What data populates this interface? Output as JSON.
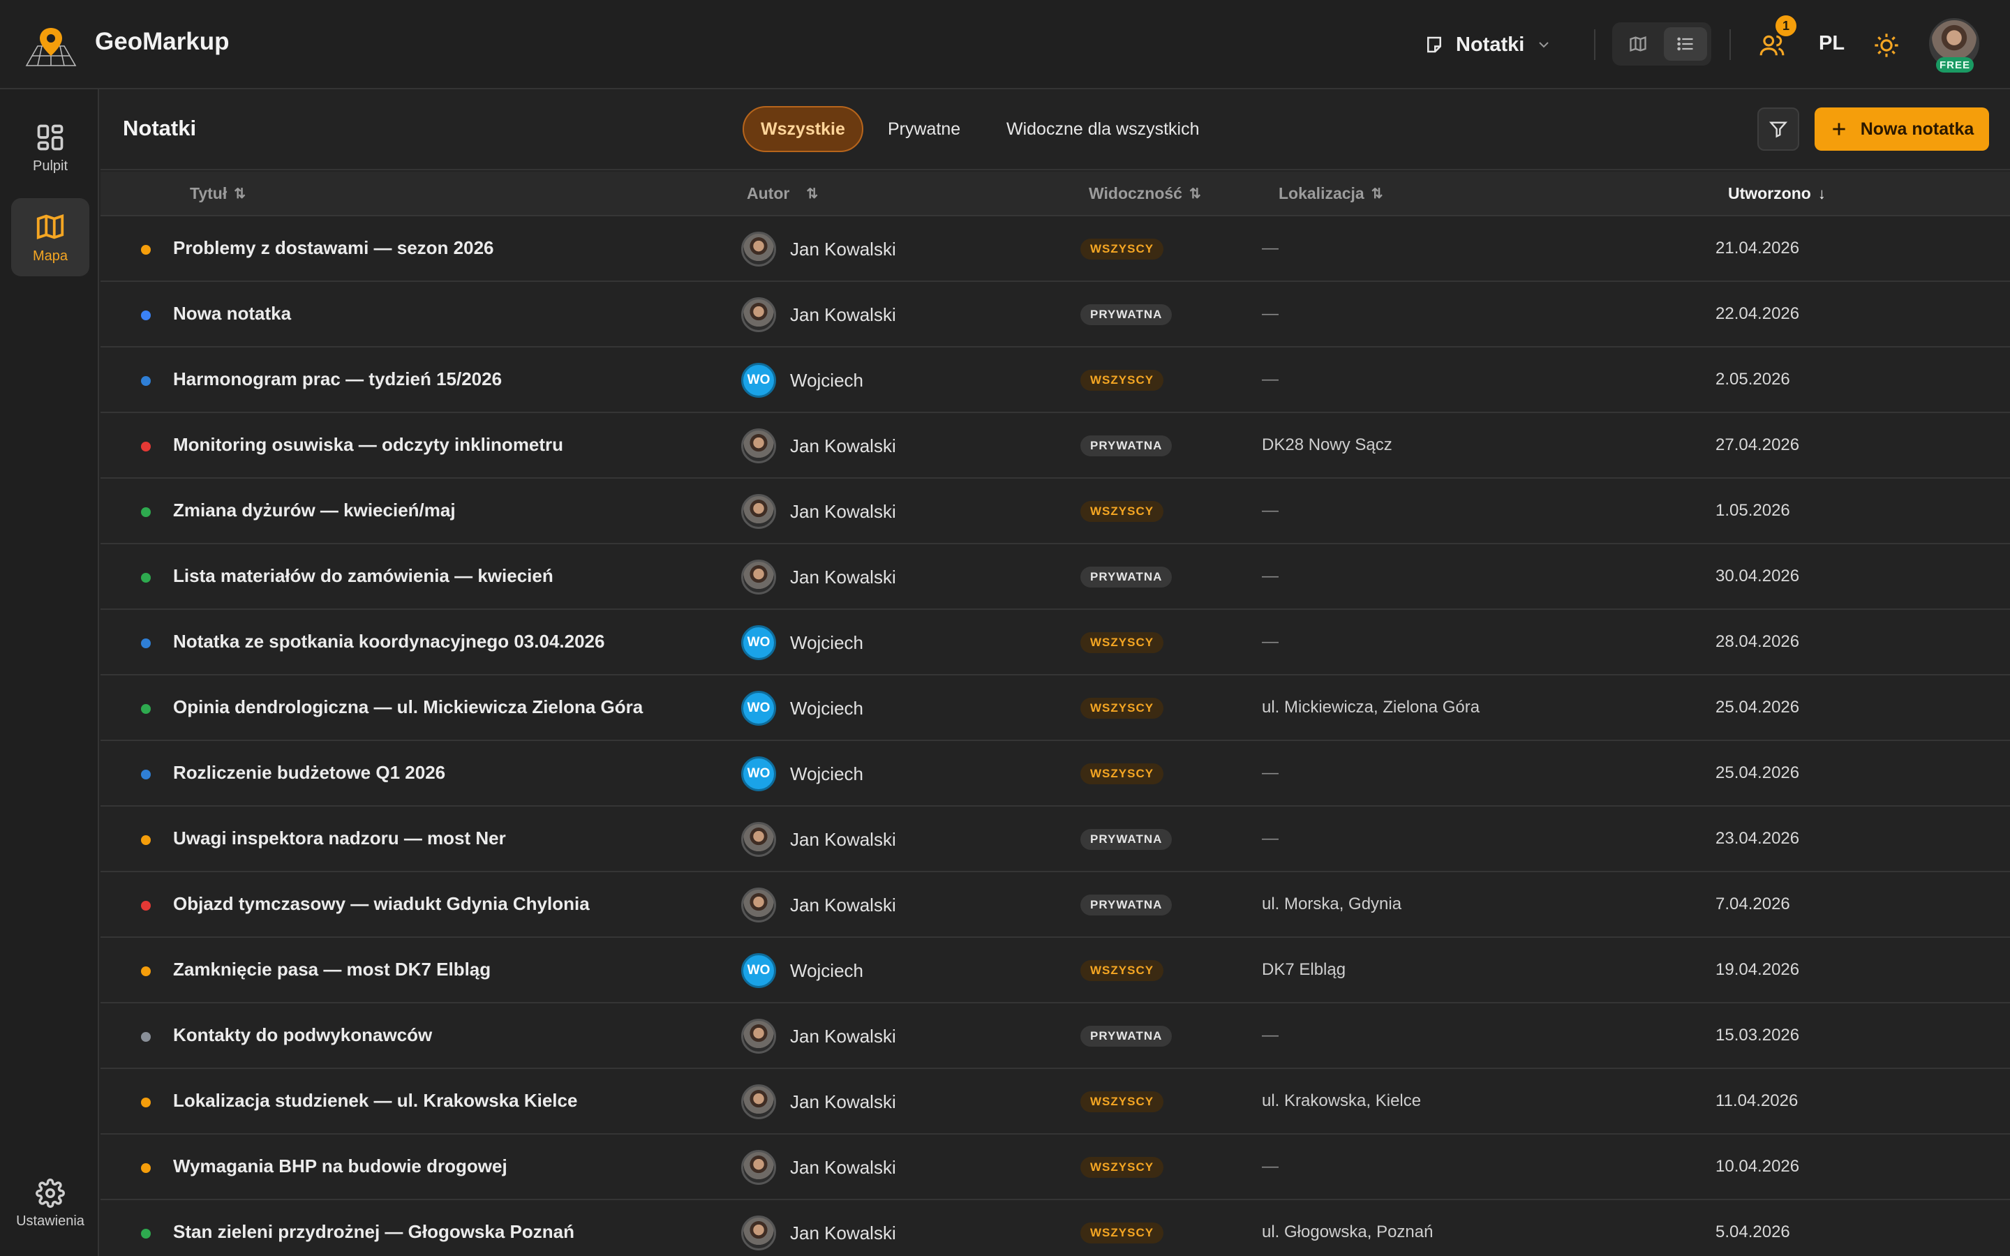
{
  "app": {
    "brand": "GeoMarkup",
    "mode_label": "Notatki",
    "language": "PL",
    "notifications_count": "1",
    "plan_badge": "FREE"
  },
  "sidebar": {
    "items": [
      {
        "label": "Pulpit",
        "icon": "dashboard-icon"
      },
      {
        "label": "Mapa",
        "icon": "map-icon",
        "active": true
      }
    ],
    "settings_label": "Ustawienia"
  },
  "content": {
    "title": "Notatki",
    "tabs": [
      "Wszystkie",
      "Prywatne",
      "Widoczne dla wszystkich"
    ],
    "active_tab": "Wszystkie",
    "new_note_label": "Nowa notatka"
  },
  "table": {
    "columns": {
      "title": "Tytuł",
      "author": "Autor",
      "visibility": "Widoczność",
      "location": "Lokalizacja",
      "created": "Utworzono"
    },
    "sorted_by": "Utworzono",
    "rows": [
      {
        "dot": "#f59e0b",
        "title": "Problemy z dostawami — sezon 2026",
        "author": "Jan Kowalski",
        "avatar": "photo",
        "visibility": "WSZYSCY",
        "vis_type": "all",
        "location": "—",
        "created": "21.04.2026"
      },
      {
        "dot": "#3b82f6",
        "title": "Nowa notatka",
        "author": "Jan Kowalski",
        "avatar": "photo",
        "visibility": "PRYWATNA",
        "vis_type": "priv",
        "location": "—",
        "created": "22.04.2026"
      },
      {
        "dot": "#2f7fd6",
        "title": "Harmonogram prac — tydzień 15/2026",
        "author": "Wojciech",
        "avatar": "WO",
        "visibility": "WSZYSCY",
        "vis_type": "all",
        "location": "—",
        "created": "2.05.2026"
      },
      {
        "dot": "#e53935",
        "title": "Monitoring osuwiska — odczyty inklinometru",
        "author": "Jan Kowalski",
        "avatar": "photo",
        "visibility": "PRYWATNA",
        "vis_type": "priv",
        "location": "DK28 Nowy Sącz",
        "created": "27.04.2026"
      },
      {
        "dot": "#2eaa4f",
        "title": "Zmiana dyżurów — kwiecień/maj",
        "author": "Jan Kowalski",
        "avatar": "photo",
        "visibility": "WSZYSCY",
        "vis_type": "all",
        "location": "—",
        "created": "1.05.2026"
      },
      {
        "dot": "#2eaa4f",
        "title": "Lista materiałów do zamówienia — kwiecień",
        "author": "Jan Kowalski",
        "avatar": "photo",
        "visibility": "PRYWATNA",
        "vis_type": "priv",
        "location": "—",
        "created": "30.04.2026"
      },
      {
        "dot": "#2f7fd6",
        "title": "Notatka ze spotkania koordynacyjnego 03.04.2026",
        "author": "Wojciech",
        "avatar": "WO",
        "visibility": "WSZYSCY",
        "vis_type": "all",
        "location": "—",
        "created": "28.04.2026"
      },
      {
        "dot": "#2eaa4f",
        "title": "Opinia dendrologiczna — ul. Mickiewicza Zielona Góra",
        "author": "Wojciech",
        "avatar": "WO",
        "visibility": "WSZYSCY",
        "vis_type": "all",
        "location": "ul. Mickiewicza, Zielona Góra",
        "created": "25.04.2026"
      },
      {
        "dot": "#2f7fd6",
        "title": "Rozliczenie budżetowe Q1 2026",
        "author": "Wojciech",
        "avatar": "WO",
        "visibility": "WSZYSCY",
        "vis_type": "all",
        "location": "—",
        "created": "25.04.2026"
      },
      {
        "dot": "#f59e0b",
        "title": "Uwagi inspektora nadzoru — most Ner",
        "author": "Jan Kowalski",
        "avatar": "photo",
        "visibility": "PRYWATNA",
        "vis_type": "priv",
        "location": "—",
        "created": "23.04.2026"
      },
      {
        "dot": "#e53935",
        "title": "Objazd tymczasowy — wiadukt Gdynia Chylonia",
        "author": "Jan Kowalski",
        "avatar": "photo",
        "visibility": "PRYWATNA",
        "vis_type": "priv",
        "location": "ul. Morska, Gdynia",
        "created": "7.04.2026"
      },
      {
        "dot": "#f59e0b",
        "title": "Zamknięcie pasa — most DK7 Elbląg",
        "author": "Wojciech",
        "avatar": "WO",
        "visibility": "WSZYSCY",
        "vis_type": "all",
        "location": "DK7 Elbląg",
        "created": "19.04.2026"
      },
      {
        "dot": "#8a9099",
        "title": "Kontakty do podwykonawców",
        "author": "Jan Kowalski",
        "avatar": "photo",
        "visibility": "PRYWATNA",
        "vis_type": "priv",
        "location": "—",
        "created": "15.03.2026"
      },
      {
        "dot": "#f59e0b",
        "title": "Lokalizacja studzienek — ul. Krakowska Kielce",
        "author": "Jan Kowalski",
        "avatar": "photo",
        "visibility": "WSZYSCY",
        "vis_type": "all",
        "location": "ul. Krakowska, Kielce",
        "created": "11.04.2026"
      },
      {
        "dot": "#f59e0b",
        "title": "Wymagania BHP na budowie drogowej",
        "author": "Jan Kowalski",
        "avatar": "photo",
        "visibility": "WSZYSCY",
        "vis_type": "all",
        "location": "—",
        "created": "10.04.2026"
      },
      {
        "dot": "#2eaa4f",
        "title": "Stan zieleni przydrożnej — Głogowska Poznań",
        "author": "Jan Kowalski",
        "avatar": "photo",
        "visibility": "WSZYSCY",
        "vis_type": "all",
        "location": "ul. Głogowska, Poznań",
        "created": "5.04.2026"
      }
    ]
  }
}
